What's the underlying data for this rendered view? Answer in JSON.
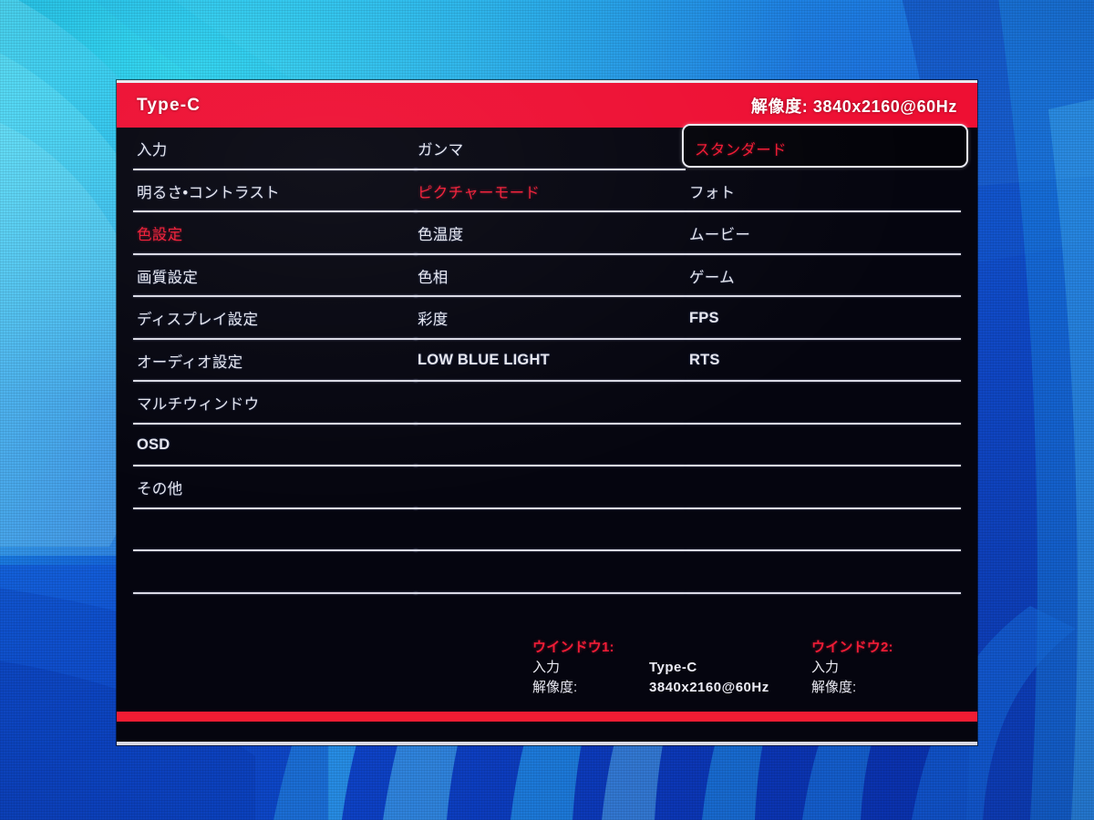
{
  "osd": {
    "header": {
      "input_label": "Type-C",
      "resolution_label": "解像度: 3840x2160@60Hz"
    },
    "menu_column": [
      {
        "label": "入力",
        "state": "normal",
        "script": "jp"
      },
      {
        "label": "明るさ•コントラスト",
        "state": "normal",
        "script": "jp"
      },
      {
        "label": "色設定",
        "state": "accent",
        "script": "jp"
      },
      {
        "label": "画質設定",
        "state": "normal",
        "script": "jp"
      },
      {
        "label": "ディスプレイ設定",
        "state": "normal",
        "script": "jp"
      },
      {
        "label": "オーディオ設定",
        "state": "normal",
        "script": "jp"
      },
      {
        "label": "マルチウィンドウ",
        "state": "normal",
        "script": "jp"
      },
      {
        "label": "OSD",
        "state": "normal",
        "script": "latin"
      },
      {
        "label": "その他",
        "state": "normal",
        "script": "jp"
      },
      {
        "label": "",
        "state": "empty",
        "script": "jp"
      },
      {
        "label": "",
        "state": "empty",
        "script": "jp"
      }
    ],
    "submenu_column": [
      {
        "label": "ガンマ",
        "state": "normal",
        "script": "jp"
      },
      {
        "label": "ピクチャーモード",
        "state": "accent",
        "script": "jp"
      },
      {
        "label": "色温度",
        "state": "normal",
        "script": "jp"
      },
      {
        "label": "色相",
        "state": "normal",
        "script": "jp"
      },
      {
        "label": "彩度",
        "state": "normal",
        "script": "jp"
      },
      {
        "label": "LOW BLUE LIGHT",
        "state": "normal",
        "script": "latin"
      },
      {
        "label": "",
        "state": "empty",
        "script": "jp"
      },
      {
        "label": "",
        "state": "empty",
        "script": "jp"
      },
      {
        "label": "",
        "state": "empty",
        "script": "jp"
      },
      {
        "label": "",
        "state": "empty",
        "script": "jp"
      },
      {
        "label": "",
        "state": "empty",
        "script": "jp"
      }
    ],
    "option_column": [
      {
        "label": "スタンダード",
        "state": "selected",
        "script": "jp"
      },
      {
        "label": "フォト",
        "state": "normal",
        "script": "jp"
      },
      {
        "label": "ムービー",
        "state": "normal",
        "script": "jp"
      },
      {
        "label": "ゲーム",
        "state": "normal",
        "script": "jp"
      },
      {
        "label": "FPS",
        "state": "normal",
        "script": "latin"
      },
      {
        "label": "RTS",
        "state": "normal",
        "script": "latin"
      },
      {
        "label": "",
        "state": "empty",
        "script": "jp"
      },
      {
        "label": "",
        "state": "empty",
        "script": "jp"
      },
      {
        "label": "",
        "state": "empty",
        "script": "jp"
      },
      {
        "label": "",
        "state": "empty",
        "script": "jp"
      },
      {
        "label": "",
        "state": "empty",
        "script": "jp"
      }
    ],
    "window_info": [
      {
        "title": "ウインドウ1:",
        "input_key": "入力",
        "input_value": "Type-C",
        "resolution_key": "解像度:",
        "resolution_value": "3840x2160@60Hz"
      },
      {
        "title": "ウインドウ2:",
        "input_key": "入力",
        "input_value": "",
        "resolution_key": "解像度:",
        "resolution_value": ""
      }
    ]
  },
  "colors": {
    "accent_red": "#ee0f33",
    "text_red": "#f01c36",
    "panel_background": "#05050f",
    "rule": "#d9d9e4",
    "text": "#e6e6ee",
    "wallpaper_blue": "#1568dd",
    "wallpaper_cyan": "#2fd8ef"
  }
}
